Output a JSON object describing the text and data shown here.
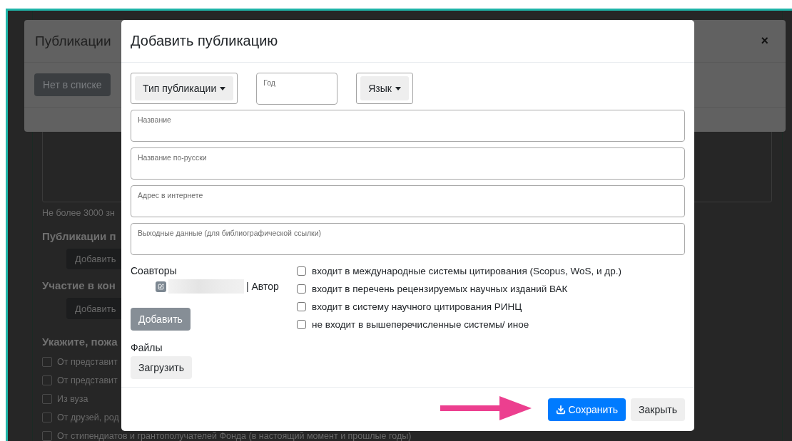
{
  "page": {
    "hint": "Не более 3000 зн",
    "sections": [
      {
        "heading": "Публикации п",
        "button": "Добавить"
      },
      {
        "heading": "Участие в кон",
        "button": "Добавить"
      }
    ],
    "question": "Укажите, пожа",
    "options": [
      {
        "label": "От представит",
        "checked": false
      },
      {
        "label": "От представит",
        "checked": false
      },
      {
        "label": "Из вуза",
        "checked": false
      },
      {
        "label": "От друзей, род",
        "checked": false
      },
      {
        "label": "От стипендиатов и грантополучателей Фонда (в настоящий момент и прошлые годы)",
        "checked": false
      }
    ]
  },
  "back_dialog": {
    "title": "Публикации",
    "button": "Нет в списке",
    "close": "×"
  },
  "dialog": {
    "title": "Добавить публикацию",
    "type_dropdown": "Тип публикации",
    "year": {
      "placeholder": "Год"
    },
    "language_dropdown": "Язык",
    "fields": [
      {
        "placeholder": "Название"
      },
      {
        "placeholder": "Название по-русски"
      },
      {
        "placeholder": "Адрес в интернете"
      },
      {
        "placeholder": "Выходные данные (для библиографической ссылки)"
      }
    ],
    "coauthors": {
      "label": "Соавторы",
      "entries": [
        {
          "role": "| Автор"
        }
      ]
    },
    "add_button": "Добавить",
    "files_label": "Файлы",
    "upload_button": "Загрузить",
    "criteria": [
      {
        "label": "входит в международные системы цитирования (Scopus, WoS, и др.)",
        "checked": false
      },
      {
        "label": "входит в перечень рецензируемых научных изданий ВАК",
        "checked": false
      },
      {
        "label": "входит в систему научного цитирования РИНЦ",
        "checked": false
      },
      {
        "label": "не входит в вышеперечисленные системы/ иное",
        "checked": false
      }
    ],
    "save_button": "Сохранить",
    "close_button": "Закрыть"
  }
}
